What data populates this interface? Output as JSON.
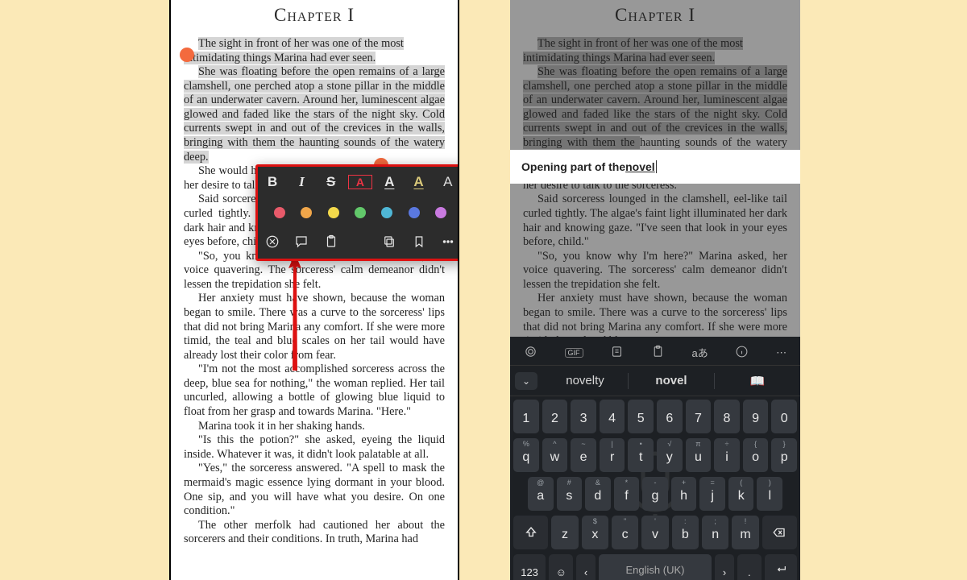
{
  "chapter_title": "Chapter I",
  "paragraphs": {
    "p1a": "The sight in front of her was one of the most ",
    "p1b": "intimidating things Marina had ever seen.",
    "p2a": "She was floating before the open remains of a large clamshell, one perched atop a stone pillar in the middle of an underwater cavern. Around her, luminescent algae glowed and faded like the stars of the night sky. Cold currents swept in and out of the crevices in the walls, bringing with them the ",
    "p2b": "haunting sounds of the watery deep.",
    "p3": "She would have screamed at the eerie sight if not for her desire to talk to the sorceress.",
    "p4": "Said sorceress lounged in the clamshell, eel-like tail curled tightly. The algae's faint light illuminated her dark hair and knowing gaze. \"I've seen that look in your eyes before, child.\"",
    "p5": "\"So, you know why I'm here?\" Marina asked, her voice quavering. The sorceress' calm demeanor didn't lessen the trepidation she felt.",
    "p6": "Her anxiety must have shown, because the woman began to smile. There was a curve to the sorceress' lips that did not bring Marina any comfort. If she were more timid, the teal and blue scales on her tail would have already lost their color from fear.",
    "p7": "\"I'm not the most accomplished sorceress across the deep, blue sea for nothing,\" the woman replied. Her tail uncurled, allowing a bottle of glowing blue liquid to float from her grasp and towards Marina. \"Here.\"",
    "p8": "Marina took it in her shaking hands.",
    "p9": "\"Is this the potion?\" she asked, eyeing the liquid inside. Whatever it was, it didn't look palatable at all.",
    "p10": "\"Yes,\" the sorceress answered. \"A spell to mask the mermaid's magic essence lying dormant in your blood. One sip, and you will have what you desire. On one condition.\"",
    "p11": "The other merfolk had cautioned her about the sorcerers and their conditions. In truth, Marina had"
  },
  "right_paragraphs_short": {
    "p6_cut": "Her anxiety must have shown, because the woman began to smile. There was a curve to the sorceress' lips that did not bring Marina any comfort. If she were more timid, the teal and blue"
  },
  "format_popup": {
    "bold": "B",
    "italic": "I",
    "strike": "S",
    "boxed_a": "A",
    "underline_a": "A",
    "capital_a1": "A",
    "capital_a2": "A",
    "colors": [
      "#e85a6a",
      "#f0a64a",
      "#f3d94b",
      "#62c86a",
      "#4fb7d6",
      "#5a78e0",
      "#c97ae0"
    ]
  },
  "note": {
    "prefix": "Opening part of the ",
    "underlined": "novel"
  },
  "keyboard": {
    "suggestions": [
      "novelty",
      "novel",
      "📖"
    ],
    "row1_nums": [
      "1",
      "2",
      "3",
      "4",
      "5",
      "6",
      "7",
      "8",
      "9",
      "0"
    ],
    "row2_alts": [
      "%",
      "^",
      "~",
      "|",
      "•",
      "√",
      "π",
      "÷",
      "{",
      "}"
    ],
    "row2": [
      "q",
      "w",
      "e",
      "r",
      "t",
      "y",
      "u",
      "i",
      "o",
      "p"
    ],
    "row3_alts": [
      "@",
      "#",
      "&",
      "*",
      "-",
      "+",
      "=",
      "(",
      ")"
    ],
    "row3": [
      "a",
      "s",
      "d",
      "f",
      "g",
      "h",
      "j",
      "k",
      "l"
    ],
    "row4_alts": [
      "",
      "",
      "$",
      "\"",
      "'",
      ":",
      ";",
      "!",
      "?"
    ],
    "row4": [
      "z",
      "x",
      "c",
      "v",
      "b",
      "n",
      "m"
    ],
    "numkey": "123",
    "space": "English (UK)",
    "toolbar": {
      "gif": "GIF",
      "translate": "aあ"
    }
  }
}
